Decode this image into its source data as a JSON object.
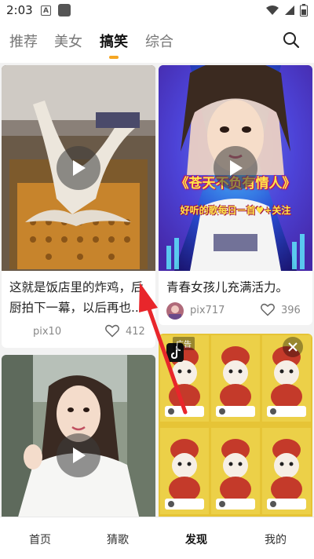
{
  "status_bar": {
    "time": "2:03",
    "notification_letter": "A"
  },
  "tabs": [
    {
      "label": "推荐",
      "active": false
    },
    {
      "label": "美女",
      "active": false
    },
    {
      "label": "搞笑",
      "active": true
    },
    {
      "label": "综合",
      "active": false
    }
  ],
  "cards": [
    {
      "title_line1": "这就是饭店里的炸鸡，后",
      "title_line2": "厨拍下一幕，以后再也...",
      "author": "pix10",
      "likes": "412"
    },
    {
      "title_line1": "青春女孩儿充满活力。",
      "author": "pix717",
      "likes": "396",
      "overlay_text_1": "《苍天不负有情人》",
      "overlay_text_2": "好听的歌每日一首♥+关注"
    },
    {
      "ad_label": "广告"
    },
    {}
  ],
  "bottom_nav": [
    {
      "label": "首页",
      "active": false
    },
    {
      "label": "猜歌",
      "active": false
    },
    {
      "label": "发现",
      "active": true
    },
    {
      "label": "我的",
      "active": false
    }
  ],
  "colors": {
    "accent": "#f5a623",
    "annotation_arrow": "#e8262b"
  }
}
